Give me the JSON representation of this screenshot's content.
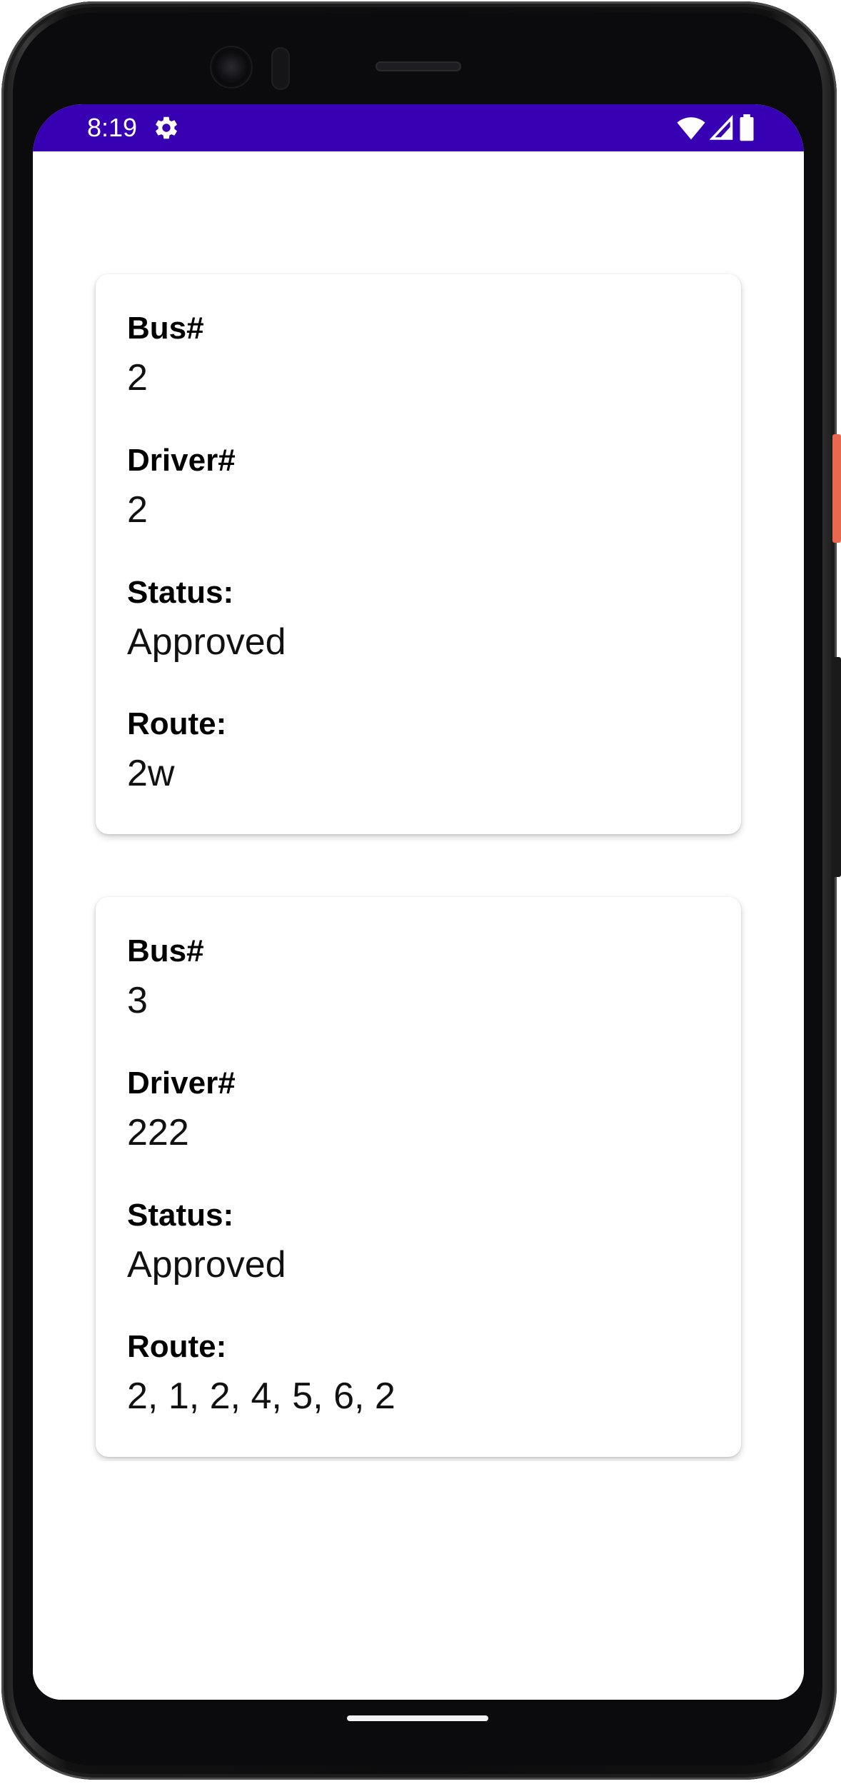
{
  "status_bar": {
    "time": "8:19",
    "background": "#3700b3",
    "icons": [
      "settings-gear-icon",
      "wifi-icon",
      "cell-signal-icon",
      "battery-icon"
    ]
  },
  "buses": [
    {
      "bus_label": "Bus#",
      "bus_value": "2",
      "driver_label": "Driver#",
      "driver_value": "2",
      "status_label": "Status:",
      "status_value": "Approved",
      "route_label": "Route:",
      "route_value": "2w"
    },
    {
      "bus_label": "Bus#",
      "bus_value": "3",
      "driver_label": "Driver#",
      "driver_value": "222",
      "status_label": "Status:",
      "status_value": "Approved",
      "route_label": "Route:",
      "route_value": "2, 1, 2, 4, 5, 6, 2"
    }
  ]
}
